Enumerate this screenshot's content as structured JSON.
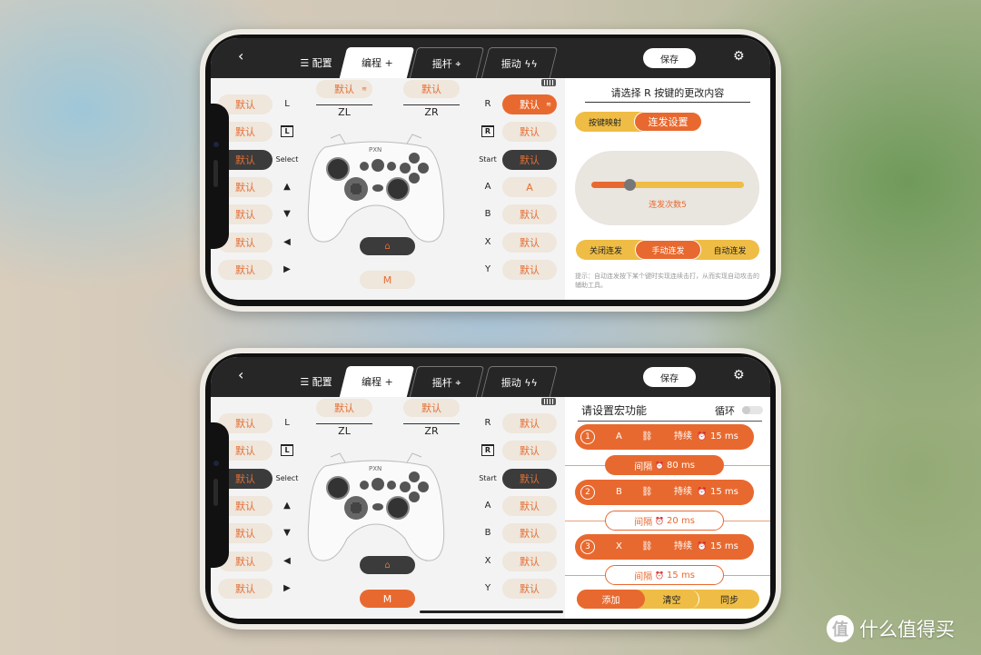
{
  "colors": {
    "accent": "#e8692f",
    "yellow": "#efbd45",
    "dark": "#262626",
    "pill": "#efe6dc"
  },
  "watermark": {
    "text": "什么值得买",
    "logo": "值"
  },
  "phones": [
    {
      "header": {
        "back_icon": "chevron-left-icon",
        "tabs": [
          "☰ 配置",
          "编程 +",
          "摇杆 ⌖",
          "振动 ϟϟ"
        ],
        "save": "保存",
        "settings_icon": "gear-icon"
      },
      "zl": {
        "value": "默认",
        "label": "ZL",
        "has_turbo": true
      },
      "zr": {
        "value": "默认",
        "label": "ZR"
      },
      "left_values": [
        "默认",
        "默认",
        "默认",
        "默认",
        "默认",
        "默认",
        "默认"
      ],
      "left_labels": [
        "L",
        "LT",
        "Select",
        "▲",
        "▼",
        "◀",
        "▶"
      ],
      "right_labels": [
        "R",
        "RT",
        "Start",
        "A",
        "B",
        "X",
        "Y"
      ],
      "right_values": [
        "默认",
        "默认",
        "默认",
        "A",
        "默认",
        "默认",
        "默认"
      ],
      "right_active_index": 0,
      "home_icon": "home-icon",
      "m": "M",
      "m_active": false,
      "panel": {
        "type": "turbo",
        "title": "请选择 R 按键的更改内容",
        "mode_tabs": [
          "按键映射",
          "连发设置"
        ],
        "mode_selected": 1,
        "slider_label": "连发次数5",
        "slider_value": 5,
        "slider_fraction": 0.25,
        "turbo_modes": [
          "关闭连发",
          "手动连发",
          "自动连发"
        ],
        "turbo_selected": 1,
        "hint": "提示：自动连发按下某个键时实现连续击打，从而实现自动攻击的辅助工具。"
      }
    },
    {
      "header": {
        "back_icon": "chevron-left-icon",
        "tabs": [
          "☰ 配置",
          "编程 +",
          "摇杆 ⌖",
          "振动 ϟϟ"
        ],
        "save": "保存",
        "settings_icon": "gear-icon"
      },
      "zl": {
        "value": "默认",
        "label": "ZL",
        "has_turbo": false
      },
      "zr": {
        "value": "默认",
        "label": "ZR"
      },
      "left_values": [
        "默认",
        "默认",
        "默认",
        "默认",
        "默认",
        "默认",
        "默认"
      ],
      "left_labels": [
        "L",
        "LT",
        "Select",
        "▲",
        "▼",
        "◀",
        "▶"
      ],
      "right_labels": [
        "R",
        "RT",
        "Start",
        "A",
        "B",
        "X",
        "Y"
      ],
      "right_values": [
        "默认",
        "默认",
        "默认",
        "默认",
        "默认",
        "默认",
        "默认"
      ],
      "right_active_index": -1,
      "home_icon": "home-icon",
      "m": "M",
      "m_active": true,
      "panel": {
        "type": "macro",
        "title": "请设置宏功能",
        "loop_label": "循环",
        "loop_on": false,
        "steps": [
          {
            "num": "1",
            "key": "A",
            "hold_label": "持续",
            "hold": "15 ms",
            "gap_label": "间隔",
            "gap": "80 ms",
            "gap_selected": true
          },
          {
            "num": "2",
            "key": "B",
            "hold_label": "持续",
            "hold": "15 ms",
            "gap_label": "间隔",
            "gap": "20 ms",
            "gap_selected": false
          },
          {
            "num": "3",
            "key": "X",
            "hold_label": "持续",
            "hold": "15 ms",
            "gap_label": "间隔",
            "gap": "15 ms",
            "gap_selected": false
          }
        ],
        "actions": [
          "添加",
          "清空",
          "同步"
        ]
      }
    }
  ]
}
